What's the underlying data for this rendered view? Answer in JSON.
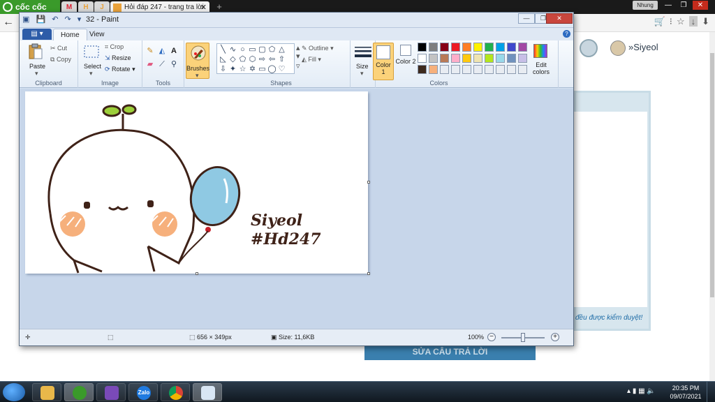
{
  "browser": {
    "logo_text": "cốc cốc",
    "pinned_tabs": [
      "M",
      "H",
      "J"
    ],
    "active_tab_title": "Hỏi đáp 247 - trang tra lời",
    "new_tab_symbol": "+",
    "user_badge": "Nhung",
    "username": "Siyeol",
    "card_text": "đều được kiểm duyệt!",
    "answer_button": "SỬA CÂU TRẢ LỜI"
  },
  "paint": {
    "title": "32 - Paint",
    "tabs": {
      "file": "▤ ▾",
      "home": "Home",
      "view": "View"
    },
    "clipboard": {
      "paste": "Paste",
      "cut": "Cut",
      "copy": "Copy",
      "label": "Clipboard"
    },
    "image": {
      "select": "Select",
      "crop": "Crop",
      "resize": "Resize",
      "rotate": "Rotate",
      "label": "Image"
    },
    "tools": {
      "label": "Tools"
    },
    "brushes": {
      "label": "Brushes"
    },
    "shapes": {
      "outline": "Outline",
      "fill": "Fill",
      "label": "Shapes"
    },
    "size": {
      "label": "Size"
    },
    "colors": {
      "color1": "Color 1",
      "color2": "Color 2",
      "edit": "Edit colors",
      "label": "Colors",
      "palette_row1": [
        "#000000",
        "#7f7f7f",
        "#880015",
        "#ed1c24",
        "#ff7f27",
        "#fff200",
        "#22b14c",
        "#00a2e8",
        "#3f48cc",
        "#a349a4"
      ],
      "palette_row2": [
        "#ffffff",
        "#c3c3c3",
        "#b97a57",
        "#ffaec9",
        "#ffc90e",
        "#efe4b0",
        "#b5e61d",
        "#99d9ea",
        "#7092be",
        "#c8bfe7"
      ],
      "palette_row3": [
        "#3d2a1e",
        "#f6b07c",
        "#e8ecf2",
        "#e8ecf2",
        "#e8ecf2",
        "#e8ecf2",
        "#e8ecf2",
        "#e8ecf2",
        "#e8ecf2",
        "#e8ecf2"
      ]
    },
    "canvas": {
      "line1": "Siyeol",
      "line2": "#Hd247"
    },
    "status": {
      "dimensions": "656 × 349px",
      "size": "Size: 11,6KB",
      "zoom": "100%"
    }
  },
  "taskbar": {
    "apps": [
      "explorer",
      "coccoc",
      "game",
      "zalo",
      "chrome",
      "paint"
    ],
    "zalo_label": "Zalo",
    "time": "20:35 PM",
    "date": "09/07/2021"
  }
}
